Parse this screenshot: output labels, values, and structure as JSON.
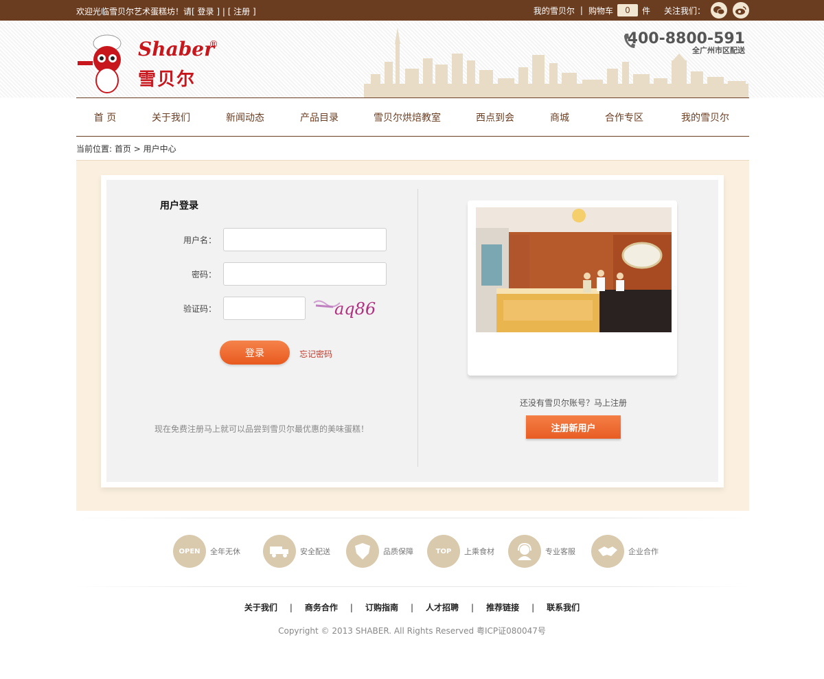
{
  "topbar": {
    "welcome_prefix": "欢迎光临雪贝尔艺术蛋糕坊！请",
    "login_link": "[ 登录 ]",
    "divider": " | ",
    "register_link": "[ 注册 ]",
    "my_account": "我的雪贝尔",
    "pipe": "|",
    "cart_label": "购物车",
    "cart_count": "0",
    "cart_unit": "件",
    "follow_label": "关注我们：",
    "icons": [
      "wechat-icon",
      "weibo-icon"
    ]
  },
  "header": {
    "logo_text": "Shaber",
    "logo_reg": "®",
    "logo_cn": "雪贝尔",
    "phone_number": "400-8800-591",
    "phone_sub": "全广州市区配送"
  },
  "nav": {
    "items": [
      "首 页",
      "关于我们",
      "新闻动态",
      "产品目录",
      "雪贝尔烘焙教室",
      "西点到会",
      "商城",
      "合作专区",
      "我的雪贝尔"
    ]
  },
  "breadcrumb": {
    "prefix": "当前位置: ",
    "home": "首页",
    "arrow": " > ",
    "current": "用户中心"
  },
  "login": {
    "title": "用户登录",
    "username_label": "用户名：",
    "password_label": "密码：",
    "captcha_label": "验证码：",
    "captcha_text": "aq86",
    "submit": "登录",
    "forgot": "忘记密码",
    "promo": "现在免费注册马上就可以品尝到雪贝尔最优惠的美味蛋糕！"
  },
  "register": {
    "prompt": "还没有雪贝尔账号？马上注册",
    "button": "注册新用户"
  },
  "features": [
    {
      "icon": "open-icon",
      "icon_text": "OPEN",
      "label": "全年无休"
    },
    {
      "icon": "delivery-truck-icon",
      "icon_text": "",
      "label": "安全配送"
    },
    {
      "icon": "quality-shield-icon",
      "icon_text": "",
      "label": "品质保障"
    },
    {
      "icon": "top-crown-icon",
      "icon_text": "TOP",
      "label": "上乘食材"
    },
    {
      "icon": "customer-service-icon",
      "icon_text": "",
      "label": "专业客服"
    },
    {
      "icon": "handshake-icon",
      "icon_text": "",
      "label": "企业合作"
    }
  ],
  "footer": {
    "links": [
      "关于我们",
      "商务合作",
      "订购指南",
      "人才招聘",
      "推荐链接",
      "联系我们"
    ],
    "separator": "|",
    "copyright": "Copyright © 2013 SHABER. All Rights Reserved 粤ICP证080047号"
  },
  "colors": {
    "brand_brown": "#6b3d20",
    "brand_red": "#c8161d",
    "accent_orange": "#e85d24",
    "page_beige": "#fbf0df"
  }
}
